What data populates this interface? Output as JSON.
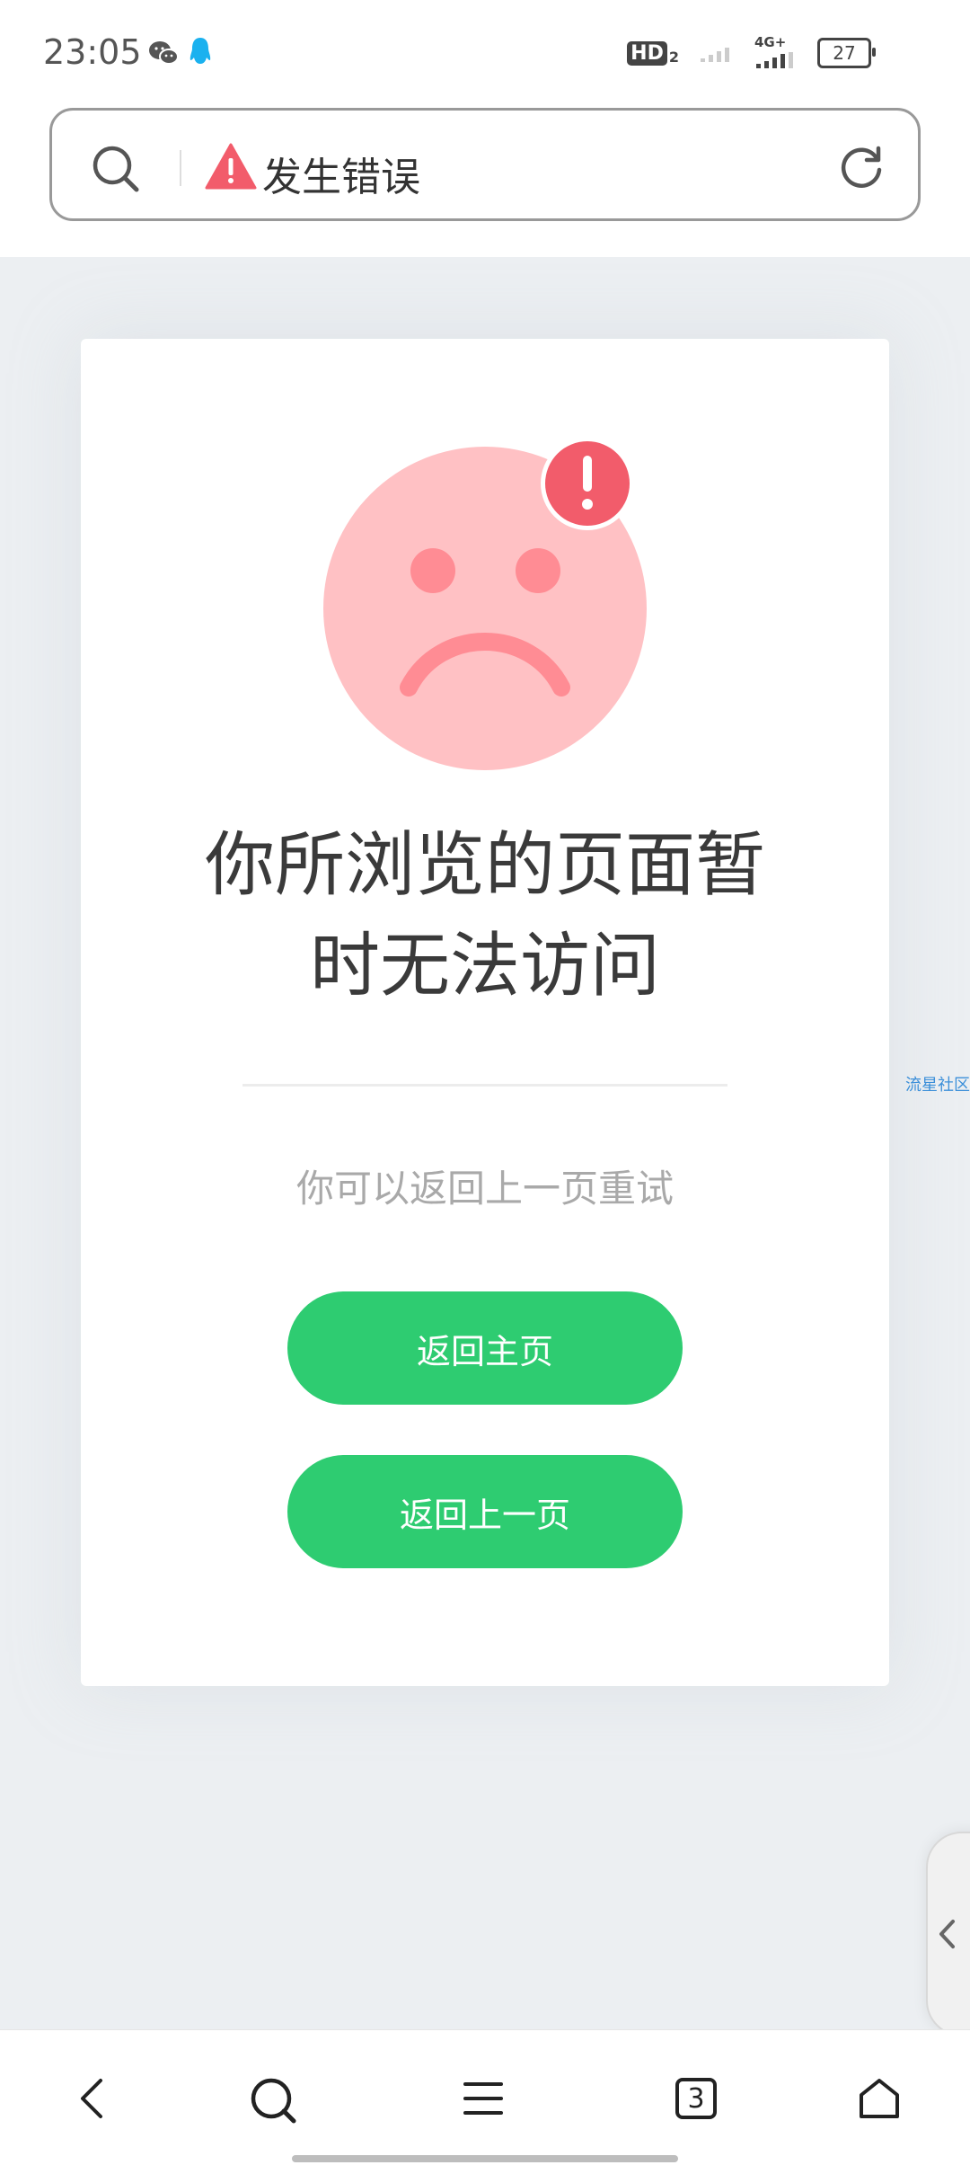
{
  "status_bar": {
    "time": "23:05",
    "hd_label": "HD",
    "hd_sub": "2",
    "network": "4G+",
    "battery": "27"
  },
  "address_bar": {
    "title": "发生错误"
  },
  "error_page": {
    "title_line1": "你所浏览的页面暂",
    "title_line2": "时无法访问",
    "subtitle": "你可以返回上一页重试",
    "home_button": "返回主页",
    "back_button": "返回上一页"
  },
  "side_label": "流星社区",
  "bottom_nav": {
    "tab_count": "3"
  },
  "colors": {
    "accent_green": "#2ecc71",
    "warning_red": "#f25c6b",
    "face_pink": "#ffc1c4"
  }
}
